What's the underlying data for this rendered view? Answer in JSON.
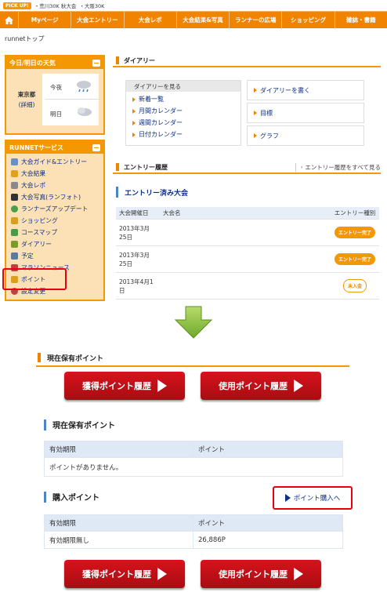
{
  "pickup": {
    "badge": "PICK UP!",
    "links": [
      "・荒川30K 秋大会",
      "・大阪30K"
    ]
  },
  "nav": {
    "items": [
      "Myページ",
      "大会エントリー",
      "大会レポ",
      "大会結果&写真",
      "ランナーの広場",
      "ショッピング",
      "雑誌・書籍"
    ]
  },
  "breadcrumb": "runnetトップ",
  "weather": {
    "title": "今日/明日の天気",
    "city": "東京都",
    "detail": "(詳細)",
    "tonight": "今夜",
    "tomorrow": "明日"
  },
  "services": {
    "title": "RUNNETサービス",
    "items": [
      {
        "label": "大会ガイド&エントリー",
        "icon": "magnifier-icon",
        "color": "#6a8fc7"
      },
      {
        "label": "大会結果",
        "icon": "medal-icon",
        "color": "#e2a020"
      },
      {
        "label": "大会レポ",
        "icon": "report-icon",
        "color": "#8a8a8a"
      },
      {
        "label": "大会写真(ランフォト)",
        "icon": "camera-icon",
        "color": "#333333"
      },
      {
        "label": "ランナーズアップデート",
        "icon": "refresh-icon",
        "color": "#4aa04a"
      },
      {
        "label": "ショッピング",
        "icon": "cart-icon",
        "color": "#d9a020"
      },
      {
        "label": "コースマップ",
        "icon": "map-icon",
        "color": "#4a9a4a"
      },
      {
        "label": "ダイアリー",
        "icon": "diary-icon",
        "color": "#7a9a2a"
      },
      {
        "label": "予定",
        "icon": "calendar-icon",
        "color": "#5a7aa0"
      },
      {
        "label": "マラソンニュース",
        "icon": "news-icon",
        "color": "#c04040"
      },
      {
        "label": "ポイント",
        "icon": "point-icon",
        "color": "#d9a020"
      },
      {
        "label": "設定変更",
        "icon": "settings-icon",
        "color": "#c04040"
      }
    ]
  },
  "diary": {
    "title": "ダイアリー",
    "view_header": "ダイアリーを見る",
    "view_links": [
      "新着一覧",
      "月間カレンダー",
      "週間カレンダー",
      "日付カレンダー"
    ],
    "right_links": [
      "ダイアリーを書く",
      "目標",
      "グラフ"
    ]
  },
  "entry": {
    "title": "エントリー履歴",
    "see_all": "エントリー履歴をすべて見る",
    "subtitle": "エントリー済み大会",
    "columns": [
      "大会開催日",
      "大会名",
      "エントリー種別"
    ],
    "rows": [
      {
        "date": "2013年3月25日",
        "name": "",
        "status": "エントリー完了",
        "kind": "done"
      },
      {
        "date": "2013年3月25日",
        "name": "",
        "status": "エントリー完了",
        "kind": "done"
      },
      {
        "date": "2013年4月1日",
        "name": "",
        "status": "未入金",
        "kind": "un"
      }
    ]
  },
  "points": {
    "header": "現在保有ポイント",
    "btn_earned": "獲得ポイント履歴",
    "btn_used": "使用ポイント履歴",
    "current_title": "現在保有ポイント",
    "columns": [
      "有効期限",
      "ポイント"
    ],
    "empty": "ポイントがありません。",
    "purchase_title": "購入ポイント",
    "purchase_link": "ポイント購入へ",
    "purchase_rows": [
      {
        "expiry": "有効期限無し",
        "points": "26,886P"
      }
    ]
  },
  "colors": {
    "orange": "#f08300",
    "red": "#e60012",
    "blue": "#4a86c5"
  }
}
